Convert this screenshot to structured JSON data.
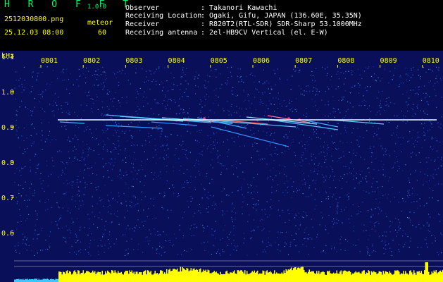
{
  "header": {
    "app_name": "H R O F F T",
    "version": "1.0.0",
    "filename": "2512030800.png",
    "datetime": "25.12.03 08:00",
    "meteor_label": "meteor",
    "meteor_count": "60",
    "fields": [
      {
        "label": "Observer",
        "value": ": Takanori Kawachi"
      },
      {
        "label": "Receiving Location",
        "value": ": Ogaki, Gifu, JAPAN (136.60E, 35.35N)"
      },
      {
        "label": "Receiver",
        "value": ": R820T2(RTL-SDR) SDR-Sharp 53.1000MHz"
      },
      {
        "label": "Receiving antenna",
        "value": ": 2el-HB9CV Vertical (el. E-W)"
      }
    ]
  },
  "spectrogram": {
    "unit_label": "kHz",
    "time_labels": [
      "0801",
      "0802",
      "0803",
      "0804",
      "0805",
      "0806",
      "0807",
      "0808",
      "0809",
      "0810"
    ],
    "freq_labels": [
      "1.1",
      "1.0",
      "0.9",
      "0.8",
      "0.7",
      "0.6"
    ],
    "freq_range_khz": [
      0.6,
      1.15
    ],
    "carrier_khz": 0.92,
    "colors": {
      "background": "#0a0f5a",
      "axis_text": "#ffff00",
      "power_bar": "#ffff00",
      "carrier": "#e8ffff"
    }
  }
}
